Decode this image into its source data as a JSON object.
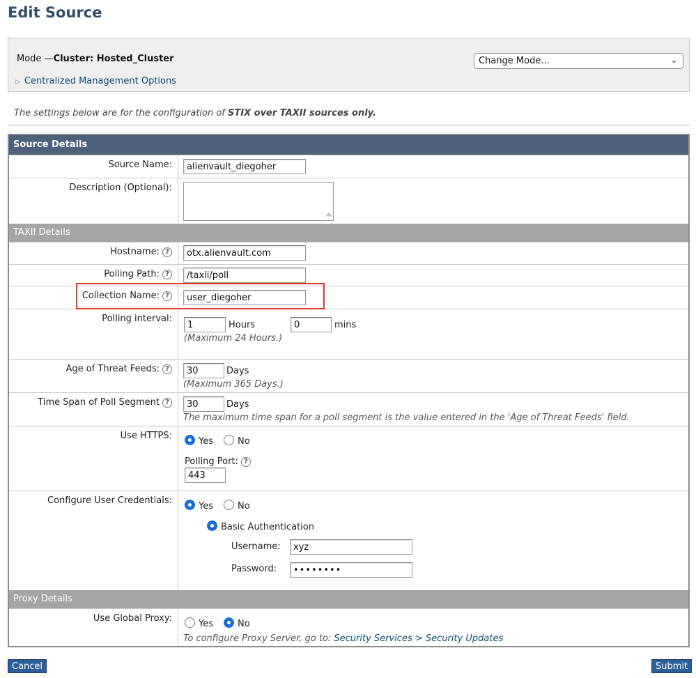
{
  "page": {
    "title": "Edit Source"
  },
  "mode": {
    "prefix": "Mode —",
    "value": "Cluster: Hosted_Cluster",
    "change_mode": "Change Mode...",
    "centralized_link": "Centralized Management Options"
  },
  "info": {
    "prefix": "The settings below are for the configuration of ",
    "bold": "STIX over TAXII sources only."
  },
  "source_details": {
    "header": "Source Details",
    "source_name_label": "Source Name:",
    "source_name_value": "alienvault_diegoher",
    "description_label": "Description (Optional):",
    "description_value": ""
  },
  "taxii": {
    "header": "TAXII Details",
    "hostname_label": "Hostname:",
    "hostname_value": "otx.alienvault.com",
    "polling_path_label": "Polling Path:",
    "polling_path_value": "/taxii/poll",
    "collection_label": "Collection Name:",
    "collection_value": "user_diegoher",
    "polling_interval_label": "Polling interval:",
    "polling_hours_value": "1",
    "hours_unit": "Hours",
    "polling_mins_value": "0",
    "mins_unit": "mins",
    "polling_note": "(Maximum 24 Hours.)",
    "age_label": "Age of Threat Feeds:",
    "age_value": "30",
    "days_unit": "Days",
    "age_note": "(Maximum 365 Days.)",
    "span_label": "Time Span of Poll Segment",
    "span_value": "30",
    "span_note": "The maximum time span for a poll segment is the value entered in the 'Age of Threat Feeds' field.",
    "https_label": "Use HTTPS:",
    "yes": "Yes",
    "no": "No",
    "polling_port_label": "Polling Port:",
    "polling_port_value": "443",
    "creds_label": "Configure User Credentials:",
    "basic_auth": "Basic Authentication",
    "username_label": "Username:",
    "username_value": "xyz",
    "password_label": "Password:",
    "password_value": "••••••••"
  },
  "proxy": {
    "header": "Proxy Details",
    "global_label": "Use Global Proxy:",
    "note_prefix": "To configure Proxy Server, go to: ",
    "link": "Security Services > Security Updates"
  },
  "buttons": {
    "cancel": "Cancel",
    "submit": "Submit"
  },
  "help_glyph": "?",
  "colors": {
    "header_bg": "#4e607a",
    "subheader_bg": "#a5a5a5",
    "highlight": "#e0382b",
    "button": "#2b5e9b",
    "radio_on": "#1a6fd6"
  }
}
